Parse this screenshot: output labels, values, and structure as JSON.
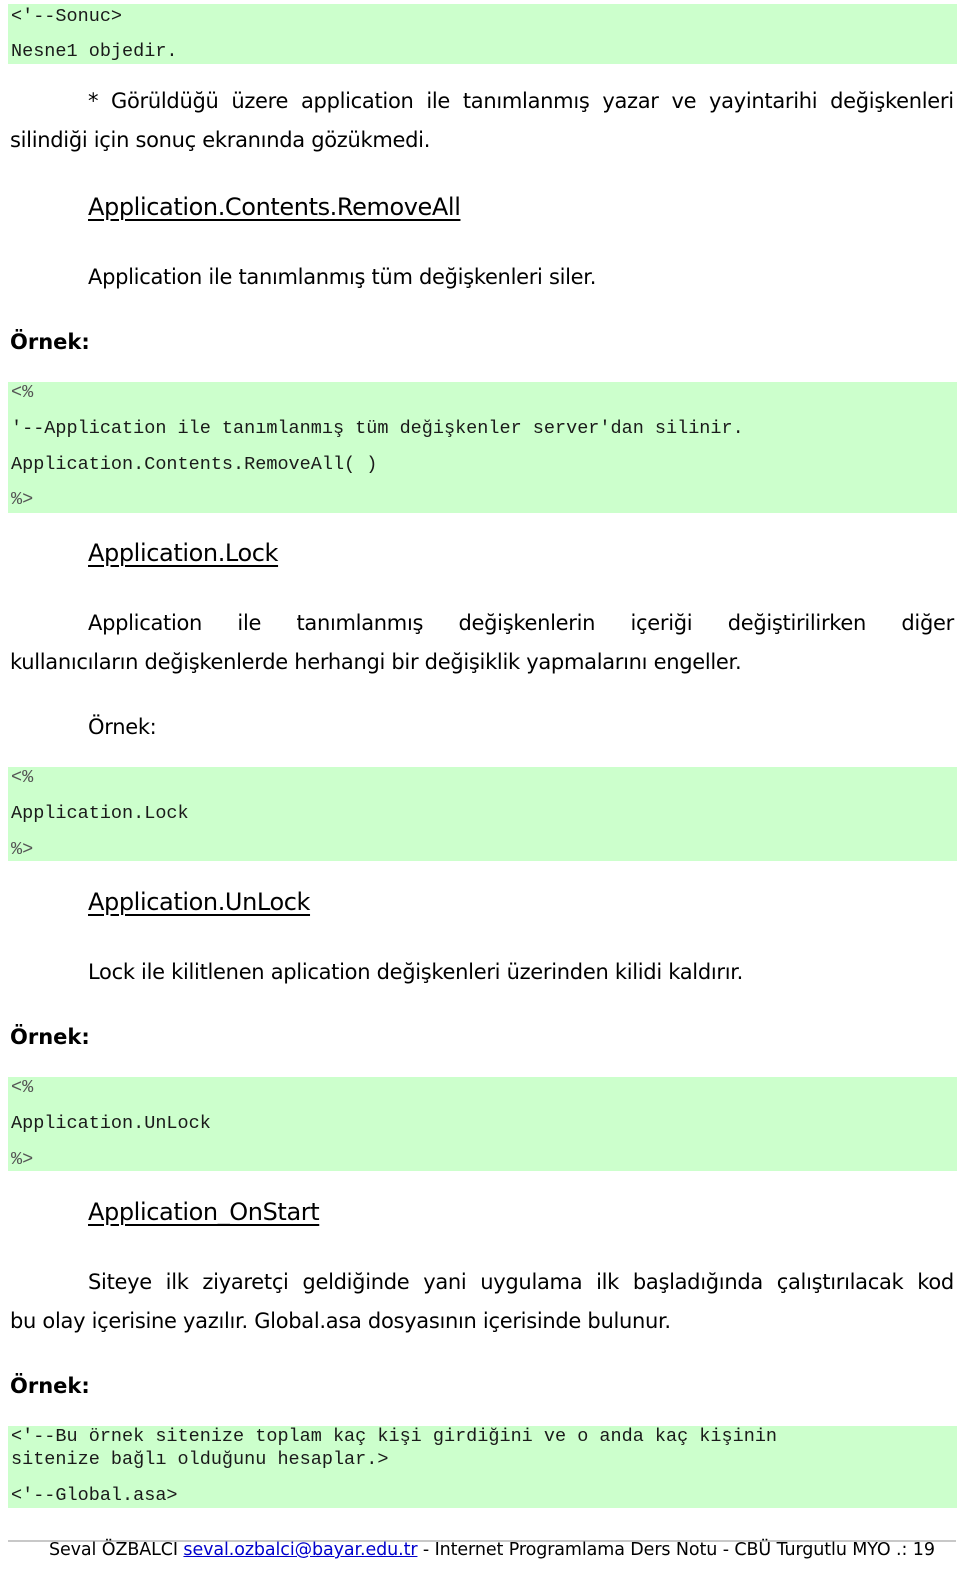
{
  "colors": {
    "code_background": "#ccffcc",
    "link": "#0000cc"
  },
  "blocks": {
    "result_code": {
      "lines": [
        "<'--Sonuc>",
        "Nesne1 objedir."
      ]
    },
    "note": {
      "line1": "* Görüldüğü üzere application ile tanımlanmış yazar ve yayintarihi değişkenleri",
      "line2": "silindiği için sonuç ekranında gözükmedi."
    },
    "remove_all": {
      "heading": "Application.Contents.RemoveAll",
      "description": "Application ile tanımlanmış tüm değişkenleri siler.",
      "example_label": "Örnek:",
      "code": {
        "open": "<%",
        "comment": "'--Application ile tanımlanmış tüm değişkenler server'dan silinir.",
        "statement": "Application.Contents.RemoveAll( )",
        "close": "%>"
      }
    },
    "lock": {
      "heading": "Application.Lock",
      "description_words": [
        "Application",
        "ile",
        "tanımlanmış",
        "değişkenlerin",
        "içeriği",
        "değiştirilirken",
        "diğer"
      ],
      "description_line2": "kullanıcıların değişkenlerde herhangi bir değişiklik yapmalarını engeller.",
      "example_label": "Örnek:",
      "code": {
        "open": "<%",
        "statement": "Application.Lock",
        "close": "%>"
      }
    },
    "unlock": {
      "heading": "Application.UnLock",
      "description": "Lock ile kilitlenen aplication değişkenleri üzerinden kilidi kaldırır.",
      "example_label": "Örnek:",
      "code": {
        "open": "<%",
        "statement": "Application.UnLock",
        "close": "%>"
      }
    },
    "on_start": {
      "heading": "Application_OnStart",
      "description_line1": "Siteye ilk ziyaretçi geldiğinde yani uygulama ilk başladığında çalıştırılacak kod",
      "description_line2": "bu olay içerisine yazılır. Global.asa dosyasının içerisinde bulunur.",
      "example_label": "Örnek:",
      "code": {
        "comment_line1": "<'--Bu örnek sitenize toplam kaç kişi girdiğini ve o anda kaç kişinin",
        "comment_line2": "sitenize bağlı olduğunu hesaplar.>",
        "file_comment": "<'--Global.asa>"
      }
    }
  },
  "footer": {
    "author": "Seval ÖZBALCI",
    "email": "seval.ozbalci@bayar.edu.tr",
    "separator": " - ",
    "course": "Internet Programlama Ders Notu - CBÜ Turgutlu MYO",
    "page_prefix": " .: ",
    "page_number": "19"
  }
}
